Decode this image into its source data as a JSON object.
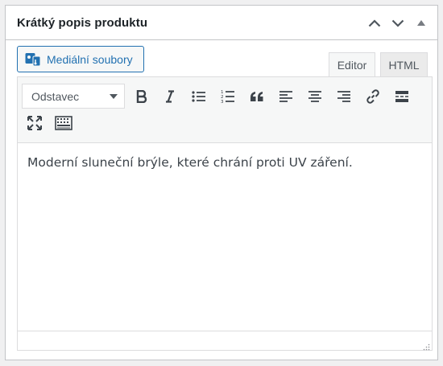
{
  "postbox": {
    "title": "Krátký popis produktu",
    "actions": [
      {
        "icon": "chevron-up-icon"
      },
      {
        "icon": "chevron-down-icon"
      },
      {
        "icon": "caret-up-icon"
      }
    ]
  },
  "media_button": {
    "label": "Mediální soubory",
    "icon": "media-icon"
  },
  "tabs": {
    "editor": "Editor",
    "html": "HTML",
    "active": "Editor"
  },
  "toolbar": {
    "format_select": {
      "selected": "Odstavec"
    },
    "buttons": [
      "bold-icon",
      "italic-icon",
      "bullet-list-icon",
      "numbered-list-icon",
      "blockquote-icon",
      "align-left-icon",
      "align-center-icon",
      "align-right-icon",
      "link-icon",
      "read-more-icon",
      "fullscreen-icon",
      "toolbar-toggle-icon"
    ]
  },
  "editor": {
    "content": "Moderní sluneční brýle, které chrání proti UV záření."
  },
  "colors": {
    "accent": "#2271b1",
    "border": "#c3c4c7",
    "toolbar_bg": "#f6f7f7"
  }
}
